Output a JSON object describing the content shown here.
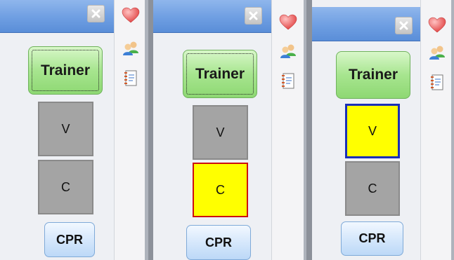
{
  "panels": [
    {
      "close_label": "Close",
      "trainer_label": "Trainer",
      "trainer_focused": true,
      "v": {
        "label": "V",
        "fill": "#a4a4a4",
        "border": "#8a8a8a"
      },
      "c": {
        "label": "C",
        "fill": "#a4a4a4",
        "border": "#8a8a8a"
      },
      "cpr_label": "CPR"
    },
    {
      "close_label": "Close",
      "trainer_label": "Trainer",
      "trainer_focused": true,
      "v": {
        "label": "V",
        "fill": "#a4a4a4",
        "border": "#8a8a8a"
      },
      "c": {
        "label": "C",
        "fill": "#ffff00",
        "border": "#cc1010"
      },
      "cpr_label": "CPR"
    },
    {
      "close_label": "Close",
      "trainer_label": "Trainer",
      "trainer_focused": false,
      "v": {
        "label": "V",
        "fill": "#ffff00",
        "border": "#1a2fb8"
      },
      "c": {
        "label": "C",
        "fill": "#a4a4a4",
        "border": "#8a8a8a"
      },
      "cpr_label": "CPR"
    }
  ],
  "sidebar_icons": [
    "heart-icon",
    "users-icon",
    "notepad-icon"
  ],
  "colors": {
    "titlebar": "#6e9ee2",
    "trainer_green": "#a7e58f",
    "cpr_blue": "#d3e6fb",
    "active_yellow": "#ffff00",
    "c_active_border": "#cc1010",
    "v_active_border": "#1a2fb8"
  }
}
